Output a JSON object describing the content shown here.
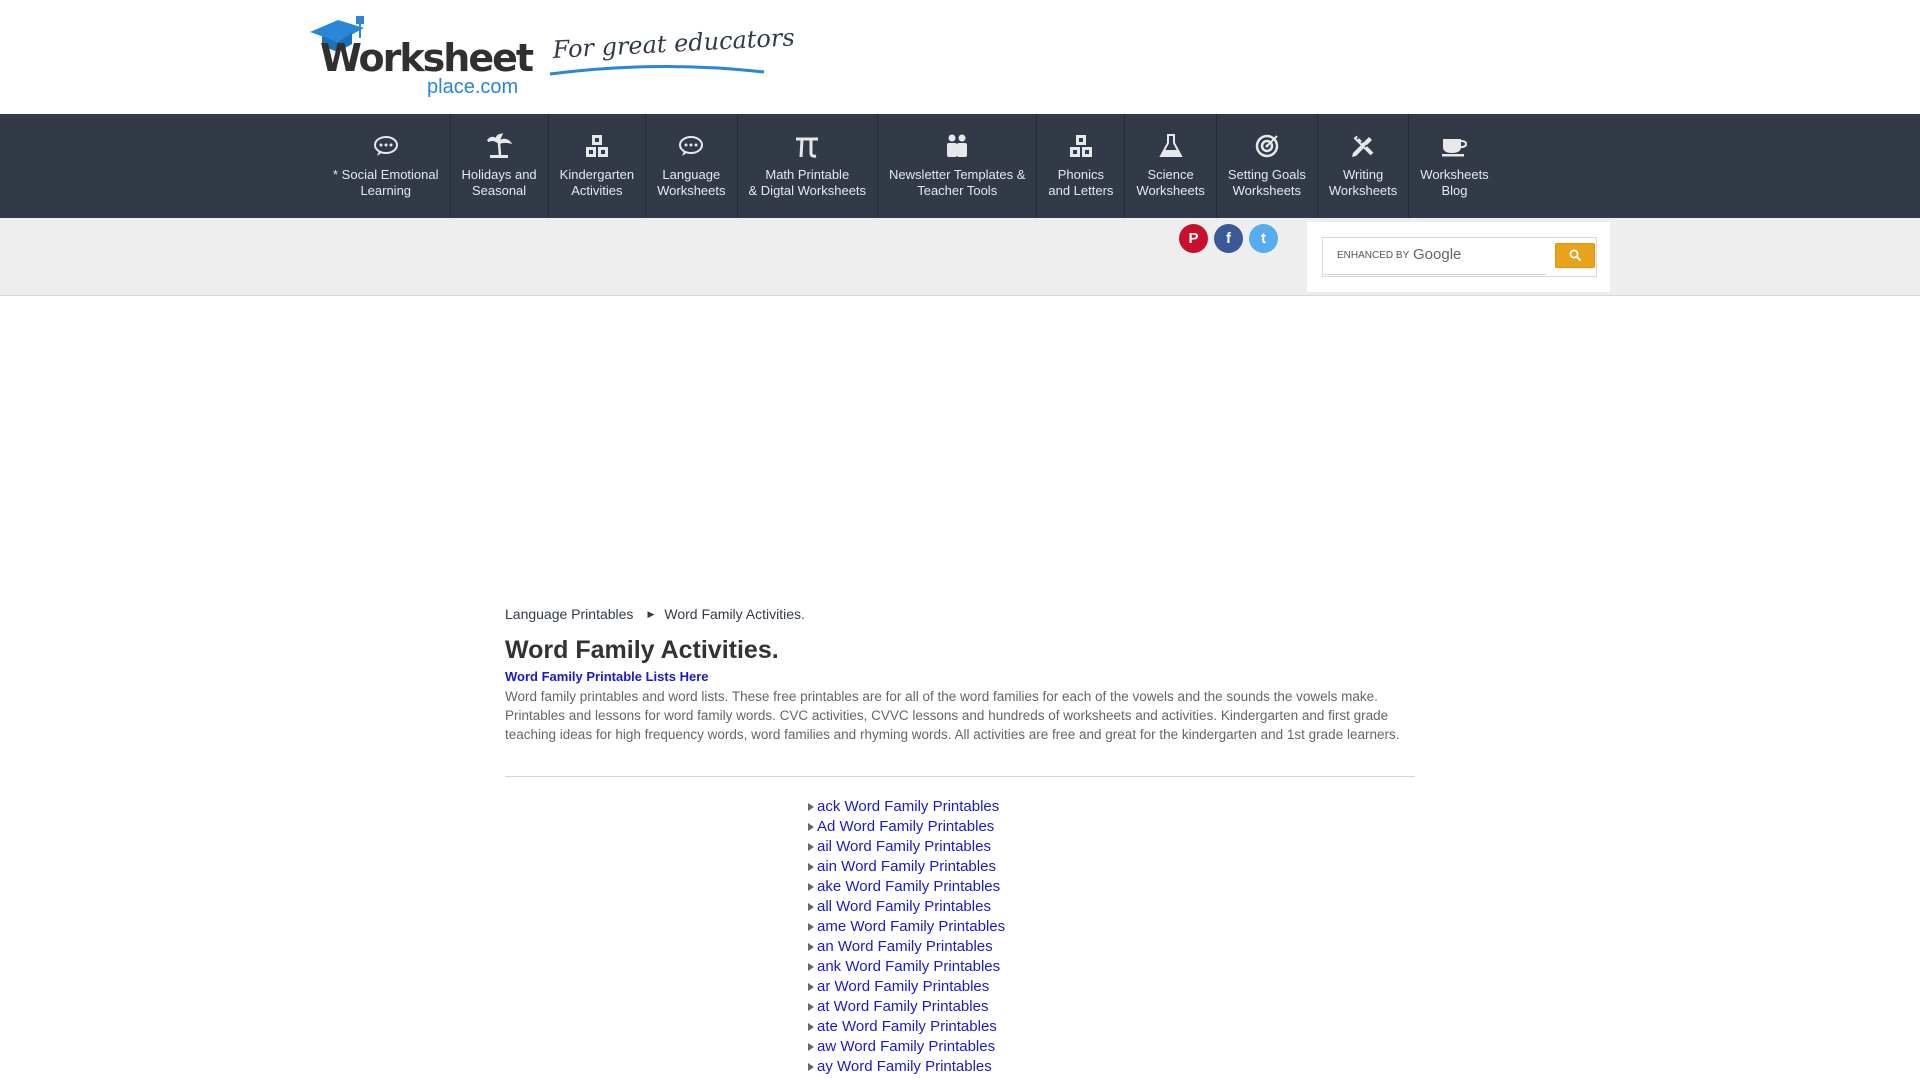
{
  "header": {
    "logo_brand": "Worksheet",
    "logo_domain": "place.com",
    "tagline": "For great educators"
  },
  "nav": {
    "items": [
      {
        "label": "* Social Emotional\nLearning",
        "icon": "speech-bubble-icon"
      },
      {
        "label": "Holidays and\nSeasonal",
        "icon": "palm-tree-icon"
      },
      {
        "label": "Kindergarten\nActivities",
        "icon": "blocks-icon"
      },
      {
        "label": "Language\nWorksheets",
        "icon": "speech-bubble-icon"
      },
      {
        "label": "Math Printable\n& Digtal Worksheets",
        "icon": "pi-icon"
      },
      {
        "label": "Newsletter Templates &\nTeacher Tools",
        "icon": "people-icon"
      },
      {
        "label": "Phonics\nand Letters",
        "icon": "blocks-icon"
      },
      {
        "label": "Science\nWorksheets",
        "icon": "flask-icon"
      },
      {
        "label": "Setting Goals\nWorksheets",
        "icon": "target-icon"
      },
      {
        "label": "Writing\nWorksheets",
        "icon": "pencil-ruler-icon"
      },
      {
        "label": "Worksheets\nBlog",
        "icon": "coffee-cup-icon"
      }
    ]
  },
  "social": {
    "pinterest": "P",
    "facebook": "f",
    "twitter": "t"
  },
  "search": {
    "enhanced_by": "ENHANCED BY",
    "google": "Google",
    "button_color": "#e8a21b"
  },
  "breadcrumb": {
    "parent": "Language Printables",
    "current": "Word Family Activities."
  },
  "main": {
    "title": "Word Family Activities.",
    "lists_link": "Word Family Printable Lists Here",
    "intro": "Word family printables and word lists. These free printables are for all of the word families for each of the vowels and the sounds the vowels make. Printables and lessons for word family words. CVC activities, CVVC lessons and hundreds of worksheets and activities. Kindergarten and first grade teaching ideas for high frequency words, word families and rhyming words. All activities are free and great for the kindergarten and 1st grade learners.",
    "links": [
      "ack Word Family Printables",
      "Ad Word Family Printables",
      "ail Word Family Printables",
      "ain Word Family Printables",
      "ake Word Family Printables",
      "all Word Family Printables",
      "ame Word Family Printables",
      "an Word Family Printables",
      "ank Word Family Printables",
      "ar Word Family Printables",
      "at Word Family Printables",
      "ate Word Family Printables",
      "aw Word Family Printables",
      "ay Word Family Printables"
    ]
  },
  "colors": {
    "nav_bg": "#323a48",
    "link": "#1a1acc",
    "logo_blue": "#2a86d6"
  }
}
